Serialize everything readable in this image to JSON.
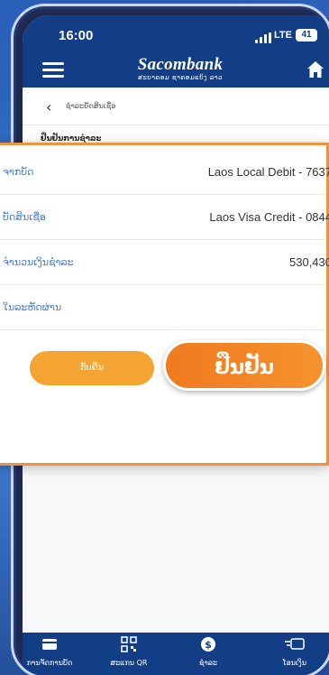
{
  "status": {
    "time": "16:00",
    "network": "LTE",
    "battery": "41"
  },
  "header": {
    "brand": "Sacombank",
    "brand_sub": "ສະບາຄອມ ຊາຄອມແບ້ງ ລາວ"
  },
  "nav": {
    "title": "ຊໍາລະຍັດສິນເຊື່ອ"
  },
  "section": {
    "title": "ຢືນຢັນການຊໍາລະ"
  },
  "details": [
    {
      "label": "ຈາກບັດ",
      "value": "Laos Local Debit - 7637"
    },
    {
      "label": "ບັດສິນເຊື່ອ",
      "value": "Laos Visa Credit - 0844"
    },
    {
      "label": "ຈໍານວນເງິນຊໍາລະ",
      "value": "530,430"
    },
    {
      "label": "ໃນລະຫັດຜ່ານ",
      "value": ""
    }
  ],
  "actions": {
    "cancel": "ກັບຄືນ",
    "confirm": "ຢືນຢັນ"
  },
  "bottom_nav": [
    {
      "label": "ການຈັດການບັດ",
      "icon": "card-icon"
    },
    {
      "label": "ສະແກນ QR",
      "icon": "qr-icon"
    },
    {
      "label": "ຊໍາລະ",
      "icon": "dollar-icon"
    },
    {
      "label": "ໂອນເງິນ",
      "icon": "transfer-icon"
    }
  ],
  "colors": {
    "brand": "#123e86",
    "accent": "#f07a1f",
    "label": "#4b7fd1"
  }
}
